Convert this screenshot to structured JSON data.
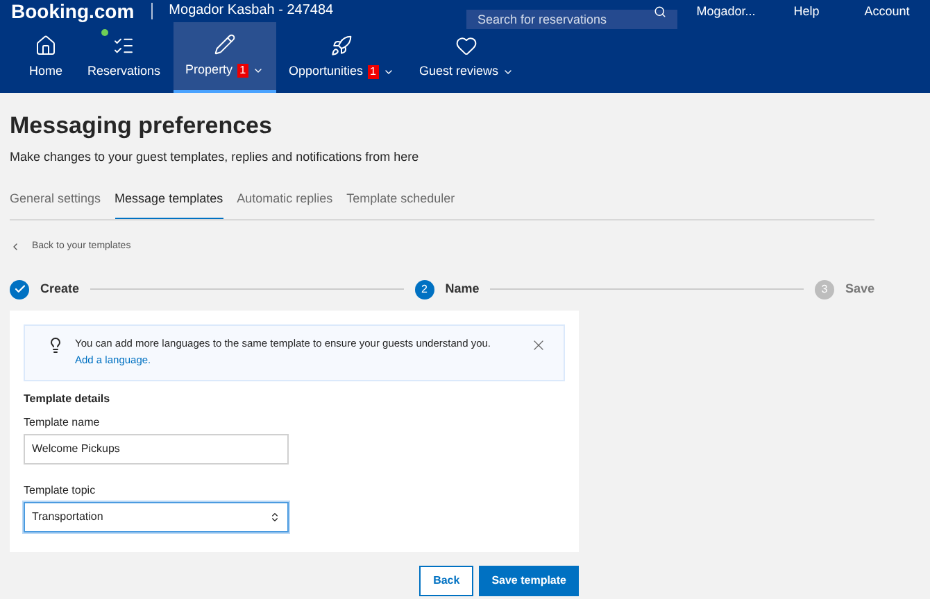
{
  "header": {
    "logo": "Booking.com",
    "property": "Mogador Kasbah - 247484",
    "search": {
      "placeholder": "Search for reservations"
    },
    "top_links": [
      "Mogador...",
      "Help",
      "Account"
    ]
  },
  "nav": [
    {
      "label": "Home",
      "selected": false,
      "notification_dot": false,
      "dropdown": false
    },
    {
      "label": "Reservations",
      "selected": false,
      "notification_dot": true,
      "dropdown": false
    },
    {
      "label": "Property",
      "selected": true,
      "badge": "1",
      "notification_dot": false,
      "dropdown": true
    },
    {
      "label": "Opportunities",
      "selected": false,
      "badge": "1",
      "notification_dot": false,
      "dropdown": true
    },
    {
      "label": "Guest reviews",
      "selected": false,
      "notification_dot": false,
      "dropdown": true
    }
  ],
  "title": "Messaging preferences",
  "subtitle": "Make changes to your guest templates, replies and notifications from here",
  "tabs": [
    {
      "label": "General settings",
      "selected": false
    },
    {
      "label": "Message templates",
      "selected": true
    },
    {
      "label": "Automatic replies",
      "selected": false
    },
    {
      "label": "Template scheduler",
      "selected": false
    }
  ],
  "back_link": "Back to your templates",
  "steps": [
    {
      "label": "Create",
      "completed": true,
      "active": false
    },
    {
      "label": "Name",
      "completed": false,
      "active": true,
      "number": "2"
    },
    {
      "label": "Save",
      "completed": false,
      "active": false,
      "number": "3"
    }
  ],
  "notice": {
    "text": "You can add more languages to the same template to ensure your guests understand you.",
    "link": "Add a language."
  },
  "section_title": "Template details",
  "fields": [
    {
      "kind": "text",
      "label": "Template name",
      "value": "Welcome Pickups",
      "focused": false
    },
    {
      "kind": "select",
      "label": "Template topic",
      "value": "Transportation",
      "focused": true
    }
  ],
  "buttons": [
    {
      "label": "Back",
      "primary": false
    },
    {
      "label": "Save template",
      "primary": true
    }
  ]
}
